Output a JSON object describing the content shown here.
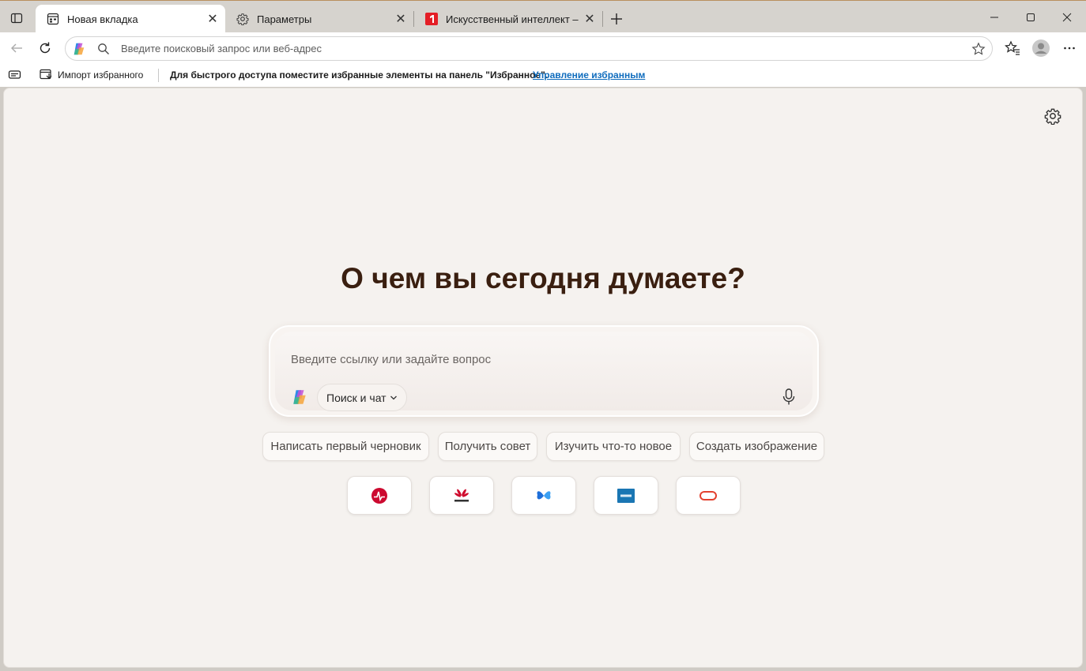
{
  "tabs": [
    {
      "title": "Новая вкладка",
      "active": true,
      "icon": "new-tab-page-icon"
    },
    {
      "title": "Параметры",
      "active": false,
      "icon": "gear-icon"
    },
    {
      "title": "Искусственный интеллект – Про",
      "active": false,
      "icon": "site-favicon-red"
    }
  ],
  "address_bar": {
    "placeholder": "Введите поисковый запрос или веб-адрес"
  },
  "favorites_bar": {
    "import_label": "Импорт избранного",
    "message": "Для быстрого доступа поместите избранные элементы на панель \"Избранное\".",
    "manage_link": "Управление избранным"
  },
  "page": {
    "headline": "О чем вы сегодня думаете?",
    "chat_placeholder": "Введите ссылку или задайте вопрос",
    "mode_label": "Поиск и чат",
    "suggestions": [
      "Написать первый черновик",
      "Получить совет",
      "Изучить что-то новое",
      "Создать изображение"
    ],
    "tiles": [
      "broadcom-logo",
      "huawei-logo",
      "butterfly-logo",
      "vmware-logo",
      "oracle-logo"
    ]
  },
  "colors": {
    "accent_link": "#0f6cbd",
    "headline": "#3a1f10",
    "page_background": "#f5f2ef"
  }
}
